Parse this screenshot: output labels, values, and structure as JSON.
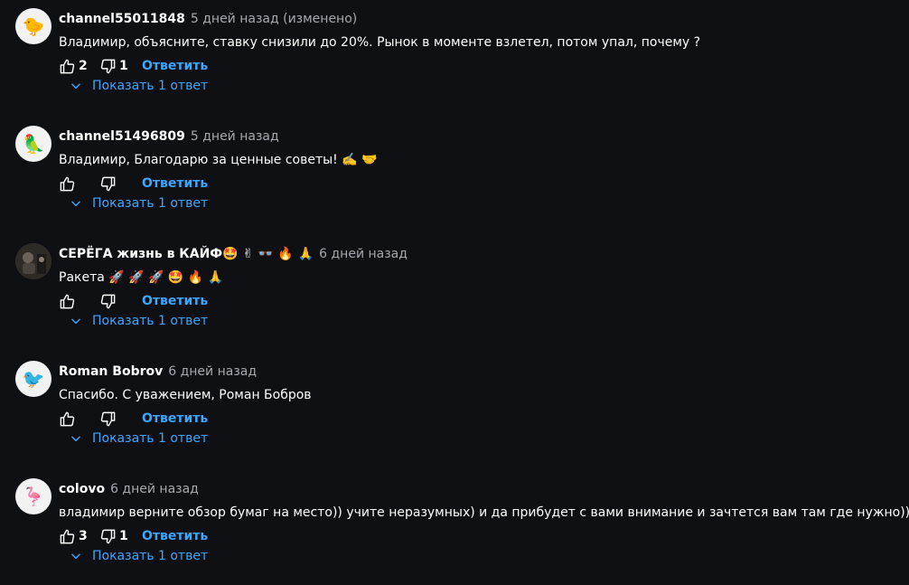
{
  "comments": [
    {
      "author": "channel55011848",
      "date": "5 дней назад (изменено)",
      "text": "Владимир, объясните, ставку снизили до 20%. Рынок в моменте взлетел, потом упал, почему ?",
      "likes": "2",
      "dislikes": "1",
      "reply_label": "Ответить",
      "replies_label": "Показать 1 ответ",
      "avatar_icon": "goose-avatar-icon",
      "avatar_bg": "#f2f2f2",
      "avatar_glyph": "🐤"
    },
    {
      "author": "channel51496809",
      "date": "5 дней назад",
      "text": "Владимир, Благодарю за ценные советы! ✍️ 🤝",
      "likes": "",
      "dislikes": "",
      "reply_label": "Ответить",
      "replies_label": "Показать 1 ответ",
      "avatar_icon": "parrot-avatar-icon",
      "avatar_bg": "#f2f2f2",
      "avatar_glyph": "🦜"
    },
    {
      "author": "СЕРЁГА жизнь в КАЙФ🤩 ✌ 👓 🔥 🙏",
      "date": "6 дней назад",
      "text": "Ракета 🚀 🚀 🚀  🤩 🔥 🙏",
      "likes": "",
      "dislikes": "",
      "reply_label": "Ответить",
      "replies_label": "Показать 1 ответ",
      "avatar_icon": "photo-avatar-icon",
      "avatar_bg": "#3a3630",
      "avatar_glyph": ""
    },
    {
      "author": "Roman Bobrov",
      "date": "6 дней назад",
      "text": "Спасибо. С уважением, Роман Бобров",
      "likes": "",
      "dislikes": "",
      "reply_label": "Ответить",
      "replies_label": "Показать 1 ответ",
      "avatar_icon": "hummingbird-avatar-icon",
      "avatar_bg": "#f2f2f2",
      "avatar_glyph": "🐦"
    },
    {
      "author": "colovo",
      "date": "6 дней назад",
      "text": "владимир верните обзор бумаг на место)) учите неразумных) и да прибудет с вами внимание  и зачтется вам  там где нужно))",
      "likes": "3",
      "dislikes": "1",
      "reply_label": "Ответить",
      "replies_label": "Показать 1 ответ",
      "avatar_icon": "flamingo-avatar-icon",
      "avatar_bg": "#f2f2f2",
      "avatar_glyph": "🦩"
    }
  ],
  "colors": {
    "background": "#0f1014",
    "link": "#3ea6ff",
    "muted": "#a7a9b0",
    "text": "#ffffff"
  }
}
